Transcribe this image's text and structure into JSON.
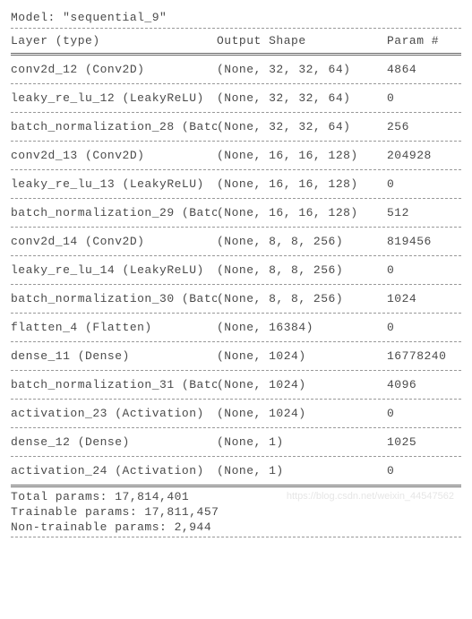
{
  "model_name_label": "Model: \"sequential_9\"",
  "header": {
    "layer": "Layer (type)",
    "shape": "Output Shape",
    "param": "Param #"
  },
  "rows": [
    {
      "layer": "conv2d_12 (Conv2D)",
      "shape": "(None, 32, 32, 64)",
      "param": "4864"
    },
    {
      "layer": "leaky_re_lu_12 (LeakyReLU)",
      "shape": "(None, 32, 32, 64)",
      "param": "0"
    },
    {
      "layer": "batch_normalization_28 (Batc",
      "shape": "(None, 32, 32, 64)",
      "param": "256"
    },
    {
      "layer": "conv2d_13 (Conv2D)",
      "shape": "(None, 16, 16, 128)",
      "param": "204928"
    },
    {
      "layer": "leaky_re_lu_13 (LeakyReLU)",
      "shape": "(None, 16, 16, 128)",
      "param": "0"
    },
    {
      "layer": "batch_normalization_29 (Batc",
      "shape": "(None, 16, 16, 128)",
      "param": "512"
    },
    {
      "layer": "conv2d_14 (Conv2D)",
      "shape": "(None, 8, 8, 256)",
      "param": "819456"
    },
    {
      "layer": "leaky_re_lu_14 (LeakyReLU)",
      "shape": "(None, 8, 8, 256)",
      "param": "0"
    },
    {
      "layer": "batch_normalization_30 (Batc",
      "shape": "(None, 8, 8, 256)",
      "param": "1024"
    },
    {
      "layer": "flatten_4 (Flatten)",
      "shape": "(None, 16384)",
      "param": "0"
    },
    {
      "layer": "dense_11 (Dense)",
      "shape": "(None, 1024)",
      "param": "16778240"
    },
    {
      "layer": "batch_normalization_31 (Batc",
      "shape": "(None, 1024)",
      "param": "4096"
    },
    {
      "layer": "activation_23 (Activation)",
      "shape": "(None, 1024)",
      "param": "0"
    },
    {
      "layer": "dense_12 (Dense)",
      "shape": "(None, 1)",
      "param": "1025"
    },
    {
      "layer": "activation_24 (Activation)",
      "shape": "(None, 1)",
      "param": "0"
    }
  ],
  "summary": {
    "total": "Total params: 17,814,401",
    "trainable": "Trainable params: 17,811,457",
    "non_trainable": "Non-trainable params: 2,944"
  },
  "watermark": "https://blog.csdn.net/weixin_44547562"
}
